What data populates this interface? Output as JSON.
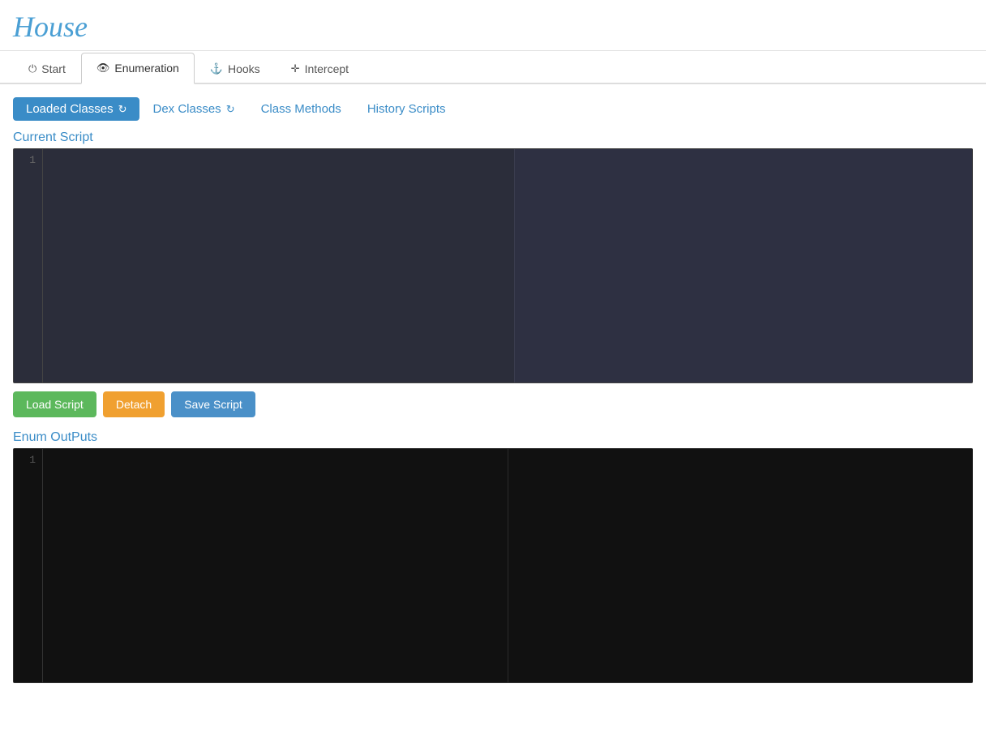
{
  "header": {
    "title": "House"
  },
  "top_nav": {
    "tabs": [
      {
        "id": "start",
        "label": "Start",
        "icon": "⏻",
        "active": false
      },
      {
        "id": "enumeration",
        "label": "Enumeration",
        "icon": "👁",
        "active": true
      },
      {
        "id": "hooks",
        "label": "Hooks",
        "icon": "⚓",
        "active": false
      },
      {
        "id": "intercept",
        "label": "Intercept",
        "icon": "✛",
        "active": false
      }
    ]
  },
  "sub_tabs": {
    "tabs": [
      {
        "id": "loaded-classes",
        "label": "Loaded Classes",
        "icon": "↻",
        "active": true
      },
      {
        "id": "dex-classes",
        "label": "Dex Classes",
        "icon": "↻",
        "active": false
      },
      {
        "id": "class-methods",
        "label": "Class Methods",
        "icon": "",
        "active": false
      },
      {
        "id": "history-scripts",
        "label": "History Scripts",
        "icon": "",
        "active": false
      }
    ]
  },
  "current_script": {
    "label": "Current Script",
    "line_number": "1"
  },
  "buttons": {
    "load_script": "Load Script",
    "detach": "Detach",
    "save_script": "Save Script"
  },
  "enum_outputs": {
    "label": "Enum OutPuts",
    "line_number": "1"
  }
}
